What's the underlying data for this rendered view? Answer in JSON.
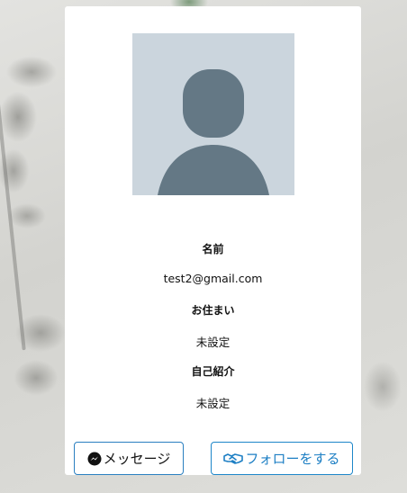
{
  "profile": {
    "name_label": "名前",
    "name_value": "test2@gmail.com",
    "address_label": "お住まい",
    "address_value": "未設定",
    "bio_label": "自己紹介",
    "bio_value": "未設定"
  },
  "actions": {
    "message_label": "メッセージ",
    "follow_label": "フォローをする"
  },
  "icons": {
    "message": "messenger-icon",
    "follow": "handshake-icon"
  },
  "colors": {
    "accent": "#1d7fc4",
    "avatar_bg": "#cbd5dd",
    "avatar_fg": "#647885"
  }
}
